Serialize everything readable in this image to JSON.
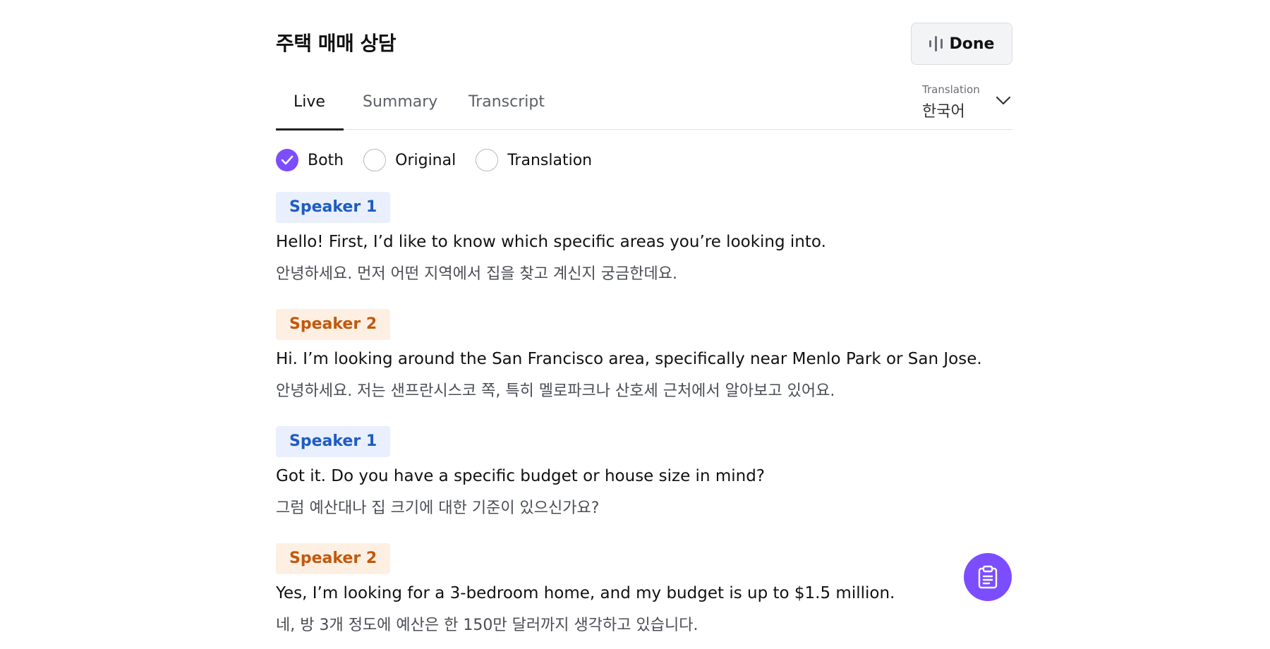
{
  "header": {
    "title": "주택 매매 상담",
    "done_label": "Done"
  },
  "tabs": [
    {
      "label": "Live",
      "active": true
    },
    {
      "label": "Summary",
      "active": false
    },
    {
      "label": "Transcript",
      "active": false
    }
  ],
  "translation": {
    "caption": "Translation",
    "selected": "한국어"
  },
  "view_mode": {
    "options": [
      {
        "label": "Both",
        "checked": true
      },
      {
        "label": "Original",
        "checked": false
      },
      {
        "label": "Translation",
        "checked": false
      }
    ]
  },
  "transcript": [
    {
      "speaker": "Speaker 1",
      "original": "Hello! First, I’d like to know which specific areas you’re looking into.",
      "translation": "안녕하세요. 먼저 어떤 지역에서 집을 찾고 계신지 궁금한데요."
    },
    {
      "speaker": "Speaker 2",
      "original": "Hi. I’m looking around the San Francisco area, specifically near Menlo Park or San Jose.",
      "translation": "안녕하세요. 저는 샌프란시스코 쪽, 특히 멜로파크나 산호세 근처에서 알아보고 있어요."
    },
    {
      "speaker": "Speaker 1",
      "original": "Got it. Do you have a specific budget or house size in mind?",
      "translation": "그럼 예산대나 집 크기에 대한 기준이 있으신가요?"
    },
    {
      "speaker": "Speaker 2",
      "original": "Yes, I’m looking for a 3-bedroom home, and my budget is up to $1.5 million.",
      "translation": "네, 방 3개 정도에 예산은 한 150만 달러까지 생각하고 있습니다."
    }
  ],
  "colors": {
    "accent": "#7c4dff",
    "speaker1_bg": "#e9effd",
    "speaker1_text": "#1d5cc2",
    "speaker2_bg": "#fdf0e3",
    "speaker2_text": "#c2580e"
  },
  "icons": {
    "done": "audio-wave-icon",
    "dropdown": "chevron-down-icon",
    "check": "check-icon",
    "fab": "clipboard-icon"
  }
}
